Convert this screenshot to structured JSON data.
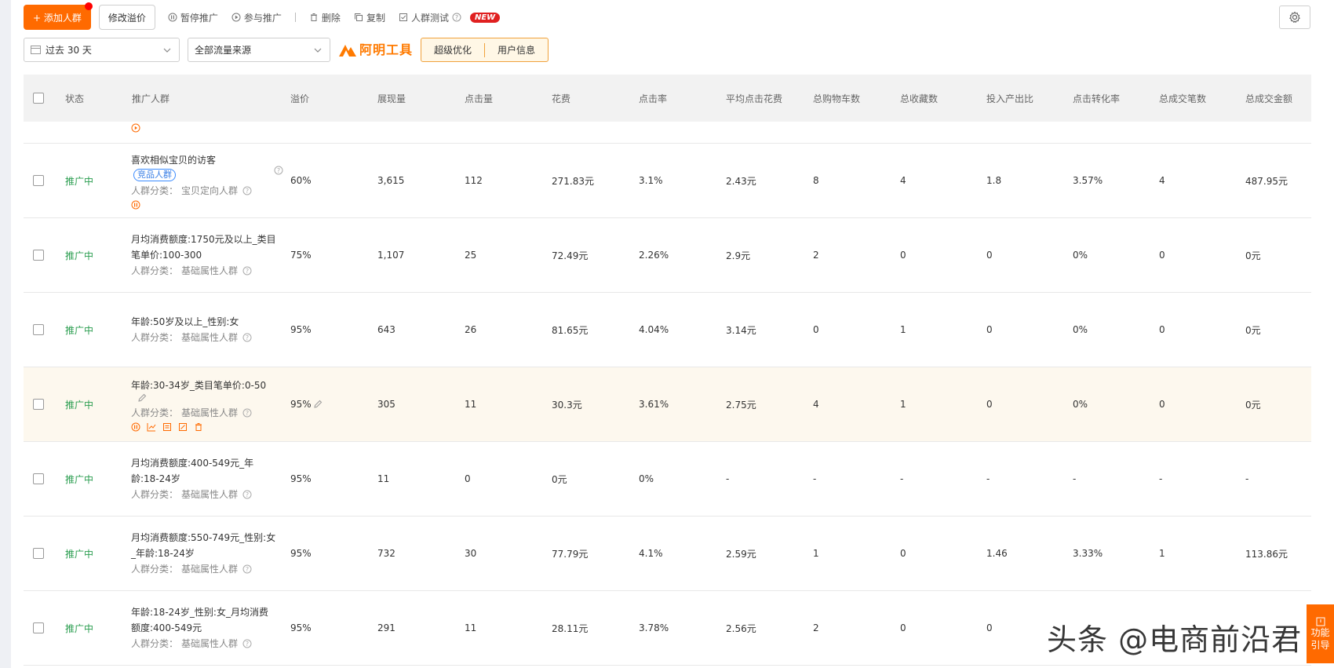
{
  "toolbar": {
    "add_label": "+ 添加人群",
    "edit_premium_label": "修改溢价",
    "pause_label": "暂停推广",
    "join_label": "参与推广",
    "delete_label": "删除",
    "copy_label": "复制",
    "crowd_test_label": "人群测试",
    "new_badge": "NEW"
  },
  "filters": {
    "date_range": "过去 30 天",
    "traffic_source": "全部流量来源",
    "logo_text": "阿明工具",
    "super_optimize": "超级优化",
    "user_info": "用户信息"
  },
  "table": {
    "columns": [
      "状态",
      "推广人群",
      "溢价",
      "展现量",
      "点击量",
      "花费",
      "点击率",
      "平均点击花费",
      "总购物车数",
      "总收藏数",
      "投入产出比",
      "点击转化率",
      "总成交笔数",
      "总成交金额"
    ],
    "cat_prefix": "人群分类：",
    "rows": [
      {
        "status": "推广中",
        "name": "喜欢相似宝贝的访客",
        "tag": "竞品人群",
        "category": "宝贝定向人群",
        "premium": "60%",
        "impressions": "3,615",
        "clicks": "112",
        "cost": "271.83元",
        "ctr": "3.1%",
        "cpc": "2.43元",
        "cart": "8",
        "fav": "4",
        "roi": "1.8",
        "cvr": "3.57%",
        "orders": "4",
        "amount": "487.95元"
      },
      {
        "status": "推广中",
        "name": "月均消费额度:1750元及以上_类目笔单价:100-300",
        "category": "基础属性人群",
        "premium": "75%",
        "impressions": "1,107",
        "clicks": "25",
        "cost": "72.49元",
        "ctr": "2.26%",
        "cpc": "2.9元",
        "cart": "2",
        "fav": "0",
        "roi": "0",
        "cvr": "0%",
        "orders": "0",
        "amount": "0元"
      },
      {
        "status": "推广中",
        "name": "年龄:50岁及以上_性别:女",
        "category": "基础属性人群",
        "premium": "95%",
        "impressions": "643",
        "clicks": "26",
        "cost": "81.65元",
        "ctr": "4.04%",
        "cpc": "3.14元",
        "cart": "0",
        "fav": "1",
        "roi": "0",
        "cvr": "0%",
        "orders": "0",
        "amount": "0元"
      },
      {
        "status": "推广中",
        "name": "年龄:30-34岁_类目笔单价:0-50",
        "category": "基础属性人群",
        "premium": "95%",
        "impressions": "305",
        "clicks": "11",
        "cost": "30.3元",
        "ctr": "3.61%",
        "cpc": "2.75元",
        "cart": "4",
        "fav": "1",
        "roi": "0",
        "cvr": "0%",
        "orders": "0",
        "amount": "0元"
      },
      {
        "status": "推广中",
        "name": "月均消费额度:400-549元_年龄:18-24岁",
        "category": "基础属性人群",
        "premium": "95%",
        "impressions": "11",
        "clicks": "0",
        "cost": "0元",
        "ctr": "0%",
        "cpc": "-",
        "cart": "-",
        "fav": "-",
        "roi": "-",
        "cvr": "-",
        "orders": "-",
        "amount": "-"
      },
      {
        "status": "推广中",
        "name": "月均消费额度:550-749元_性别:女_年龄:18-24岁",
        "category": "基础属性人群",
        "premium": "95%",
        "impressions": "732",
        "clicks": "30",
        "cost": "77.79元",
        "ctr": "4.1%",
        "cpc": "2.59元",
        "cart": "1",
        "fav": "0",
        "roi": "1.46",
        "cvr": "3.33%",
        "orders": "1",
        "amount": "113.86元"
      },
      {
        "status": "推广中",
        "name": "年龄:18-24岁_性别:女_月均消费额度:400-549元",
        "category": "基础属性人群",
        "premium": "95%",
        "impressions": "291",
        "clicks": "11",
        "cost": "28.11元",
        "ctr": "3.78%",
        "cpc": "2.56元",
        "cart": "2",
        "fav": "0",
        "roi": "0",
        "cvr": "",
        "orders": "",
        "amount": ""
      }
    ]
  },
  "watermark": "头条 @电商前沿君",
  "func_guide": "功能引导",
  "colors": {
    "accent": "#ff6a00",
    "status_green": "#2a9d4f",
    "tag_blue": "#3a7fe6",
    "highlight_row": "#fdf8ee"
  }
}
